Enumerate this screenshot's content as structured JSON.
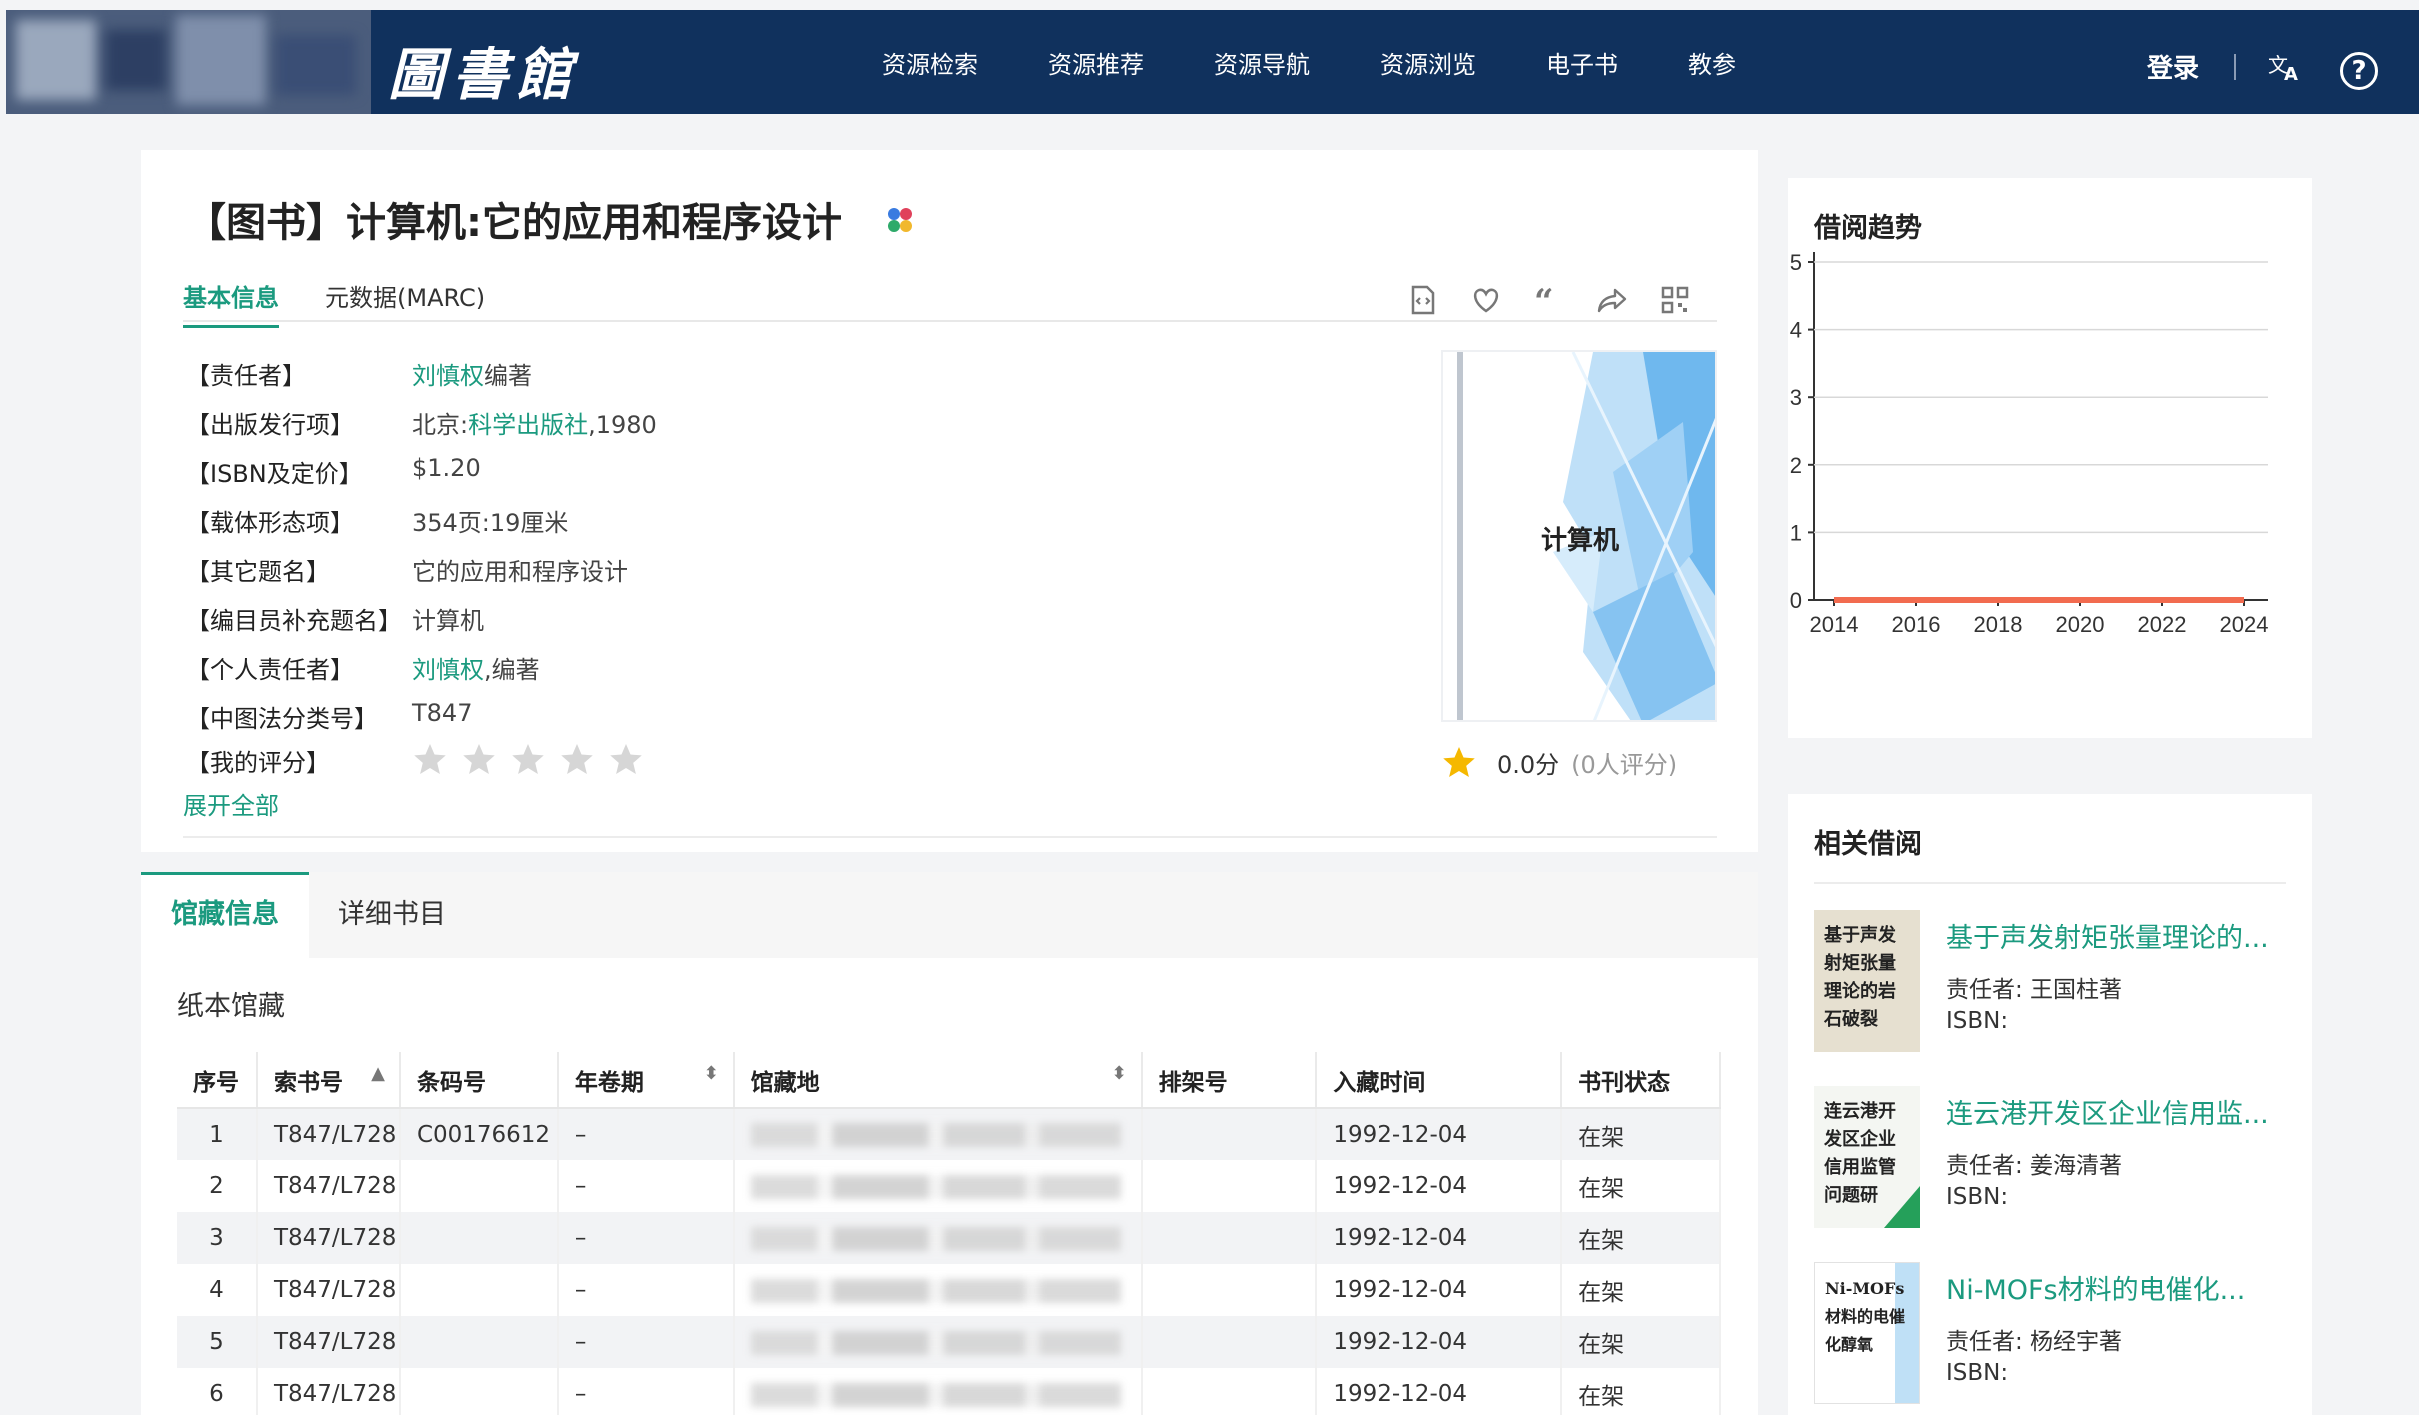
{
  "header": {
    "logo_text": "圖書館",
    "nav": [
      "资源检索",
      "资源推荐",
      "资源导航",
      "资源浏览",
      "电子书",
      "教参"
    ],
    "login": "登录"
  },
  "book": {
    "title": "【图书】计算机:它的应用和程序设计",
    "tabs": [
      "基本信息",
      "元数据(MARC)"
    ],
    "fields": {
      "responsible_label": "【责任者】",
      "responsible_link": "刘慎权",
      "responsible_suffix": "编著",
      "publish_label": "【出版发行项】",
      "publish_prefix": "北京:",
      "publish_link": "科学出版社",
      "publish_suffix": ",1980",
      "isbn_label": "【ISBN及定价】",
      "isbn_value": "$1.20",
      "carrier_label": "【载体形态项】",
      "carrier_value": "354页:19厘米",
      "other_title_label": "【其它题名】",
      "other_title_value": "它的应用和程序设计",
      "cataloger_label": "【编目员补充题名】",
      "cataloger_value": "计算机",
      "personal_label": "【个人责任者】",
      "personal_link": "刘慎权",
      "personal_suffix": ",编著",
      "clc_label": "【中图法分类号】",
      "clc_value": "T847",
      "myrating_label": "【我的评分】"
    },
    "expand_all": "展开全部",
    "cover_title": "计算机",
    "score": "0.0分",
    "rating_count": "(0人评分)",
    "my_rating_stars": 0
  },
  "holdings": {
    "tabs": [
      "馆藏信息",
      "详细书目"
    ],
    "paper_label": "纸本馆藏",
    "columns": [
      "序号",
      "索书号",
      "条码号",
      "年卷期",
      "馆藏地",
      "排架号",
      "入藏时间",
      "书刊状态"
    ],
    "rows": [
      {
        "no": "1",
        "call": "T847/L728",
        "barcode": "C00176612",
        "volume": "–",
        "shelf": "",
        "date": "1992-12-04",
        "status": "在架"
      },
      {
        "no": "2",
        "call": "T847/L728",
        "barcode": "",
        "volume": "–",
        "shelf": "",
        "date": "1992-12-04",
        "status": "在架"
      },
      {
        "no": "3",
        "call": "T847/L728",
        "barcode": "",
        "volume": "–",
        "shelf": "",
        "date": "1992-12-04",
        "status": "在架"
      },
      {
        "no": "4",
        "call": "T847/L728",
        "barcode": "",
        "volume": "–",
        "shelf": "",
        "date": "1992-12-04",
        "status": "在架"
      },
      {
        "no": "5",
        "call": "T847/L728",
        "barcode": "",
        "volume": "–",
        "shelf": "",
        "date": "1992-12-04",
        "status": "在架"
      },
      {
        "no": "6",
        "call": "T847/L728",
        "barcode": "",
        "volume": "–",
        "shelf": "",
        "date": "1992-12-04",
        "status": "在架"
      }
    ]
  },
  "trend": {
    "title": "借阅趋势",
    "chart_data": {
      "type": "line",
      "x": [
        2014,
        2015,
        2016,
        2017,
        2018,
        2019,
        2020,
        2021,
        2022,
        2023,
        2024
      ],
      "xticks": [
        "2014",
        "2016",
        "2018",
        "2020",
        "2022",
        "2024"
      ],
      "yticks": [
        "0",
        "1",
        "2",
        "3",
        "4",
        "5"
      ],
      "series": [
        {
          "values": [
            0,
            0,
            0,
            0,
            0,
            0,
            0,
            0,
            0,
            0,
            0
          ],
          "color": "#f26b4f"
        }
      ],
      "ylim": [
        0,
        5
      ],
      "grid": true
    }
  },
  "related": {
    "title": "相关借阅",
    "items": [
      {
        "title": "基于声发射矩张量理论的...",
        "author": "责任者:  王国柱著",
        "isbn": "ISBN:",
        "thumb": "基于声发射矩张量理论的岩石破裂"
      },
      {
        "title": "连云港开发区企业信用监...",
        "author": "责任者:  姜海清著",
        "isbn": "ISBN:",
        "thumb": "连云港开发区企业信用监管问题研"
      },
      {
        "title": "Ni-MOFs材料的电催化...",
        "author": "责任者:  杨经宇著",
        "isbn": "ISBN:",
        "thumb": "Ni-MOFs材料的电催化醇氧"
      }
    ]
  }
}
